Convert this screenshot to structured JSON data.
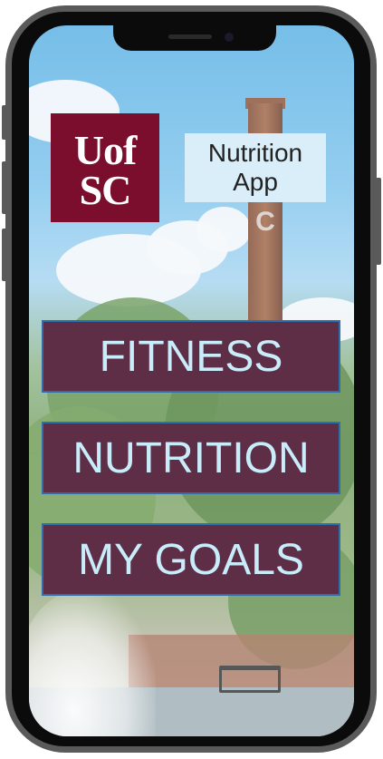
{
  "logo": {
    "line1": "Uof",
    "line2": "SC"
  },
  "app_title": "Nutrition\nApp",
  "buttons": {
    "fitness": "FITNESS",
    "nutrition": "NUTRITION",
    "goals": "MY GOALS"
  },
  "background_text": {
    "chimney_letter": "C"
  },
  "colors": {
    "brand_garnet": "#7b0e2c",
    "button_fill": "#5e2e46",
    "button_text": "#c9ecfb",
    "button_border": "#2f6eaa",
    "title_box": "#d9eef8"
  }
}
